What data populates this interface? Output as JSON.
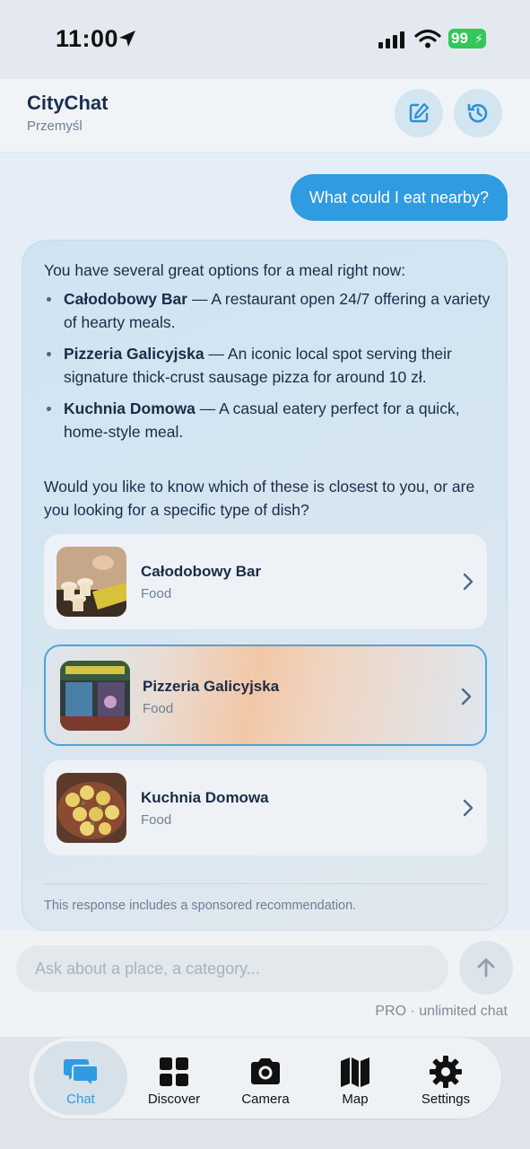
{
  "status_bar": {
    "time": "11:00",
    "battery": "99"
  },
  "header": {
    "title": "CityChat",
    "subtitle": "Przemyśl"
  },
  "chat": {
    "user_message": "What could I eat nearby?",
    "assistant": {
      "intro": "You have several great options for a meal right now:",
      "bullets": [
        {
          "name": "Całodobowy Bar",
          "text": " — A restaurant open 24/7 offering a variety of hearty meals."
        },
        {
          "name": "Pizzeria Galicyjska",
          "text": " — An iconic local spot serving their signature thick-crust sausage pizza for around 10 zł."
        },
        {
          "name": "Kuchnia Domowa",
          "text": " — A casual eatery perfect for a quick, home-style meal."
        }
      ],
      "followup": "Would you like to know which of these is closest to you, or are you looking for a specific type of dish?",
      "places": [
        {
          "name": "Całodobowy Bar",
          "category": "Food"
        },
        {
          "name": "Pizzeria Galicyjska",
          "category": "Food"
        },
        {
          "name": "Kuchnia Domowa",
          "category": "Food"
        }
      ],
      "sponsored_note": "This response includes a sponsored recommendation."
    }
  },
  "composer": {
    "placeholder": "Ask about a place, a category...",
    "plan_note": "PRO · unlimited chat"
  },
  "tabs": [
    {
      "label": "Chat",
      "icon": "chat-bubbles-icon",
      "active": true
    },
    {
      "label": "Discover",
      "icon": "grid-icon"
    },
    {
      "label": "Camera",
      "icon": "camera-icon"
    },
    {
      "label": "Map",
      "icon": "map-icon"
    },
    {
      "label": "Settings",
      "icon": "gear-icon"
    }
  ],
  "colors": {
    "accent": "#2f9be0",
    "battery": "#34c759",
    "title": "#1b3050"
  }
}
